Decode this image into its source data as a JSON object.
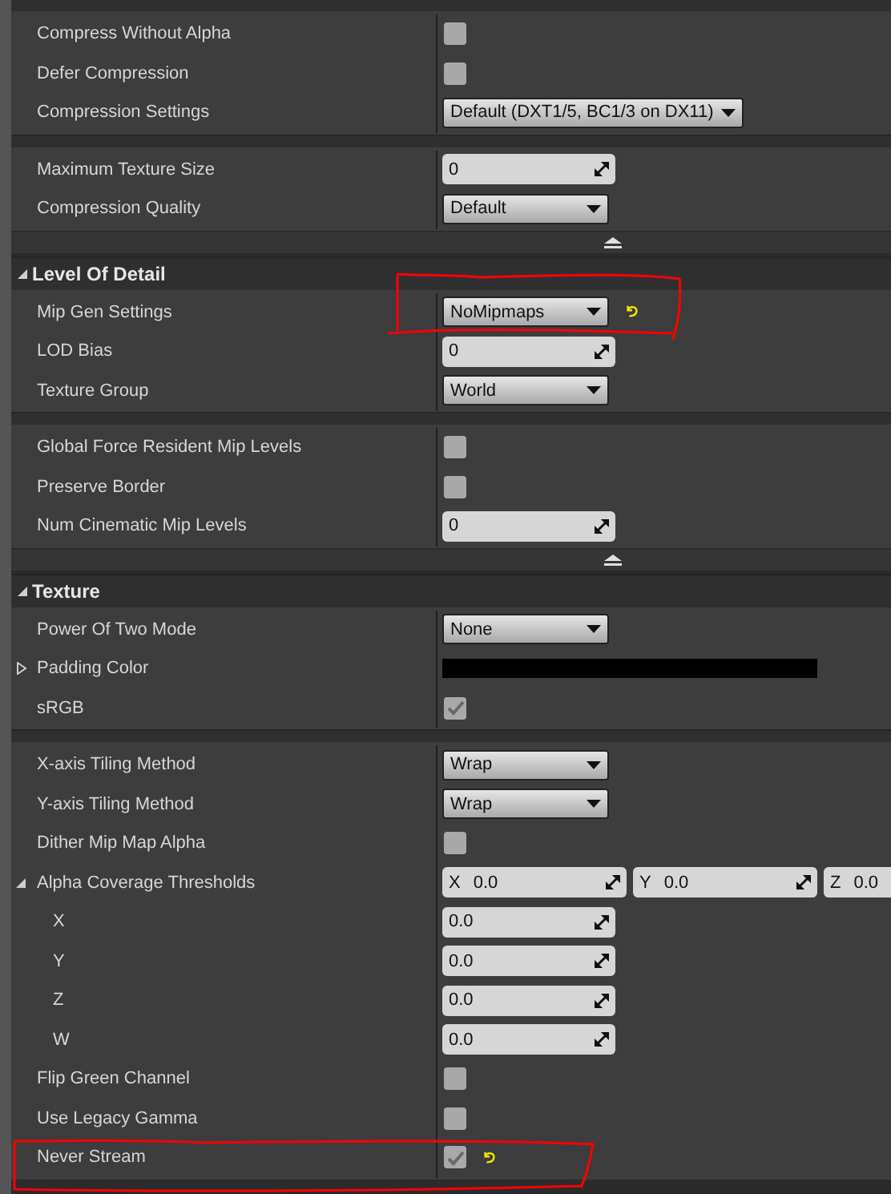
{
  "sections": [
    {
      "groups": [
        [
          {
            "label": "Compress Without Alpha",
            "kind": "checkbox",
            "checked": false,
            "reset": false
          },
          {
            "label": "Defer Compression",
            "kind": "checkbox",
            "checked": false,
            "reset": false
          },
          {
            "label": "Compression Settings",
            "kind": "combo",
            "value": "Default (DXT1/5, BC1/3 on DX11)",
            "wide": true,
            "reset": false
          }
        ],
        [
          {
            "label": "Maximum Texture Size",
            "kind": "number",
            "value": "0",
            "reset": false
          },
          {
            "label": "Compression Quality",
            "kind": "combo",
            "value": "Default",
            "reset": false
          }
        ]
      ],
      "advanced_toggle": true
    },
    {
      "title": "Level Of Detail",
      "expanded": true,
      "groups": [
        [
          {
            "label": "Mip Gen Settings",
            "kind": "combo",
            "value": "NoMipmaps",
            "reset": true
          },
          {
            "label": "LOD Bias",
            "kind": "number",
            "value": "0",
            "reset": false
          },
          {
            "label": "Texture Group",
            "kind": "combo",
            "value": "World",
            "reset": false
          }
        ],
        [
          {
            "label": "Global Force Resident Mip Levels",
            "kind": "checkbox",
            "checked": false,
            "reset": false
          },
          {
            "label": "Preserve Border",
            "kind": "checkbox",
            "checked": false,
            "reset": false
          },
          {
            "label": "Num Cinematic Mip Levels",
            "kind": "number",
            "value": "0",
            "reset": false
          }
        ]
      ],
      "advanced_toggle": true
    },
    {
      "title": "Texture",
      "expanded": true,
      "groups": [
        [
          {
            "label": "Power Of Two Mode",
            "kind": "combo",
            "value": "None",
            "reset": false
          },
          {
            "label": "Padding Color",
            "kind": "color",
            "expanded": false,
            "color": "#000000",
            "reset": false
          },
          {
            "label": "sRGB",
            "kind": "checkbox",
            "checked": true,
            "reset": false
          }
        ],
        [
          {
            "label": "X-axis Tiling Method",
            "kind": "combo",
            "value": "Wrap",
            "reset": false
          },
          {
            "label": "Y-axis Tiling Method",
            "kind": "combo",
            "value": "Wrap",
            "reset": false
          },
          {
            "label": "Dither Mip Map Alpha",
            "kind": "checkbox",
            "checked": false,
            "reset": false
          },
          {
            "label": "Alpha Coverage Thresholds",
            "kind": "vector",
            "expanded": true,
            "reset": false,
            "components": [
              {
                "axis": "X",
                "value": "0.0"
              },
              {
                "axis": "Y",
                "value": "0.0"
              },
              {
                "axis": "Z",
                "value": "0.0"
              }
            ],
            "children": [
              {
                "label": "X",
                "kind": "number",
                "value": "0.0",
                "reset": false
              },
              {
                "label": "Y",
                "kind": "number",
                "value": "0.0",
                "reset": false
              },
              {
                "label": "Z",
                "kind": "number",
                "value": "0.0",
                "reset": false
              },
              {
                "label": "W",
                "kind": "number",
                "value": "0.0",
                "reset": false
              }
            ]
          },
          {
            "label": "Flip Green Channel",
            "kind": "checkbox",
            "checked": false,
            "reset": false
          },
          {
            "label": "Use Legacy Gamma",
            "kind": "checkbox",
            "checked": false,
            "reset": false
          },
          {
            "label": "Never Stream",
            "kind": "checkbox",
            "checked": true,
            "reset": true
          }
        ]
      ],
      "advanced_toggle": false
    }
  ]
}
